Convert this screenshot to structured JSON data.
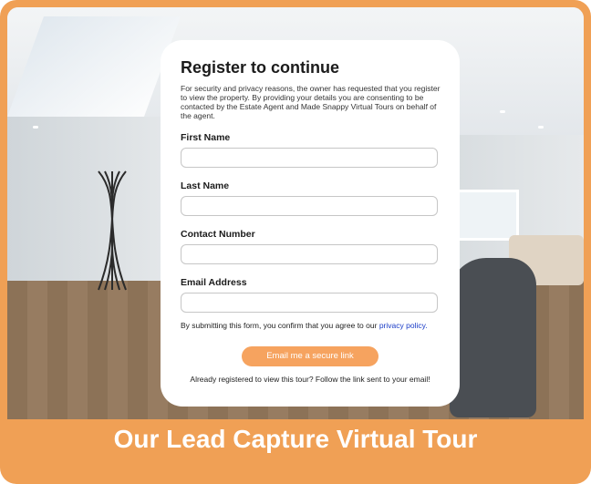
{
  "banner": {
    "text": "Our Lead Capture Virtual Tour"
  },
  "form": {
    "title": "Register to continue",
    "description": "For security and privacy reasons, the owner has requested that you register to view the property. By providing your details you are consenting to be contacted by the Estate Agent and Made Snappy Virtual Tours on behalf of the agent.",
    "fields": [
      {
        "label": "First Name",
        "value": "",
        "placeholder": ""
      },
      {
        "label": "Last Name",
        "value": "",
        "placeholder": ""
      },
      {
        "label": "Contact Number",
        "value": "",
        "placeholder": ""
      },
      {
        "label": "Email Address",
        "value": "",
        "placeholder": ""
      }
    ],
    "consent_text": "By submitting this form, you confirm that you agree to our",
    "privacy_link": "privacy policy.",
    "submit_label": "Email me a secure link",
    "already_registered": "Already registered to view this tour? Follow the link sent to your email!"
  },
  "colors": {
    "accent": "#F0A055",
    "button": "#F6A35F",
    "link": "#1A3CC7"
  }
}
